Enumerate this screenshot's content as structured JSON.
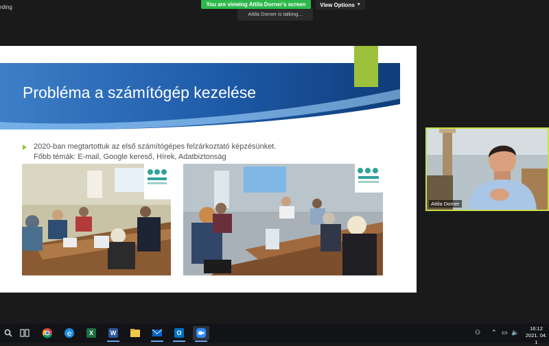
{
  "zoom": {
    "recording_text": "rding",
    "banner_text": "You are viewing Attila Dorner's screen",
    "view_options_label": "View Options",
    "talking_text": "Attila Dorner is talking..."
  },
  "slide": {
    "title": "Probléma a számítógép kezelése",
    "bullet_line1": "2020-ban megtartottuk az első számítógépes felzárkoztató képzésünket.",
    "bullet_line2": "Főbb témák: E-mail, Google kereső, Hírek, Adatbiztonság",
    "colors": {
      "band_dark": "#0f3c7a",
      "band_light": "#4c8fd3",
      "accent": "#9dc13a"
    }
  },
  "webcam": {
    "name": "Attila Dorner"
  },
  "taskbar": {
    "icons": [
      "search-icon",
      "task-view-icon",
      "chrome-icon",
      "edge-icon",
      "excel-icon",
      "word-icon",
      "file-explorer-icon",
      "mail-icon",
      "outlook-icon",
      "zoom-icon"
    ],
    "clock_time": "16:12",
    "clock_date": "2021. 04. 1"
  }
}
